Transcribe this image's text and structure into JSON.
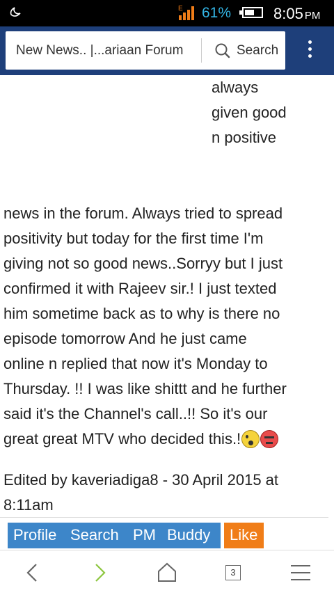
{
  "status_bar": {
    "battery_percent": "61%",
    "time": "8:05",
    "ampm": "PM",
    "battery_level": 0.61,
    "icons": [
      "moon-icon",
      "signal-icon",
      "battery-icon"
    ]
  },
  "toolbar": {
    "page_title": "New News.. |...ariaan Forum",
    "search_label": "Search",
    "icons": [
      "search-icon",
      "overflow-menu-icon"
    ],
    "colors": {
      "bar": "#1e3f7a"
    }
  },
  "post": {
    "right_column_lines": [
      "always",
      "given good",
      "n positive"
    ],
    "body_lines": [
      "news in the forum. Always tried to spread",
      "positivity but today for the first time I'm",
      "giving not so good news..Sorryy but I just",
      "confirmed it with Rajeev sir.! I just texted",
      "him sometime back as to why is there no",
      "episode tomorrow And he just came",
      "online n replied that now it's Monday to",
      "Thursday. !! I was like shittt and he further",
      "said it's the Channel's call..!! So it's our",
      "great great MTV who decided this.!"
    ],
    "emojis": [
      "shocked-emoji-icon",
      "angry-emoji-icon"
    ],
    "edited_lines": [
      "Edited by kaveriadiga8 - 30 April 2015 at",
      "8:11am"
    ]
  },
  "actions": {
    "profile": "Profile",
    "search": "Search",
    "pm": "PM",
    "buddy": "Buddy",
    "like": "Like",
    "colors": {
      "blue": "#3d86c9",
      "like": "#f07d18"
    }
  },
  "bottom_nav": {
    "tab_count": "3",
    "icons": [
      "back-icon",
      "forward-icon",
      "home-icon",
      "tabs-icon",
      "menu-icon"
    ],
    "colors": {
      "forward": "#8dc63f"
    }
  }
}
